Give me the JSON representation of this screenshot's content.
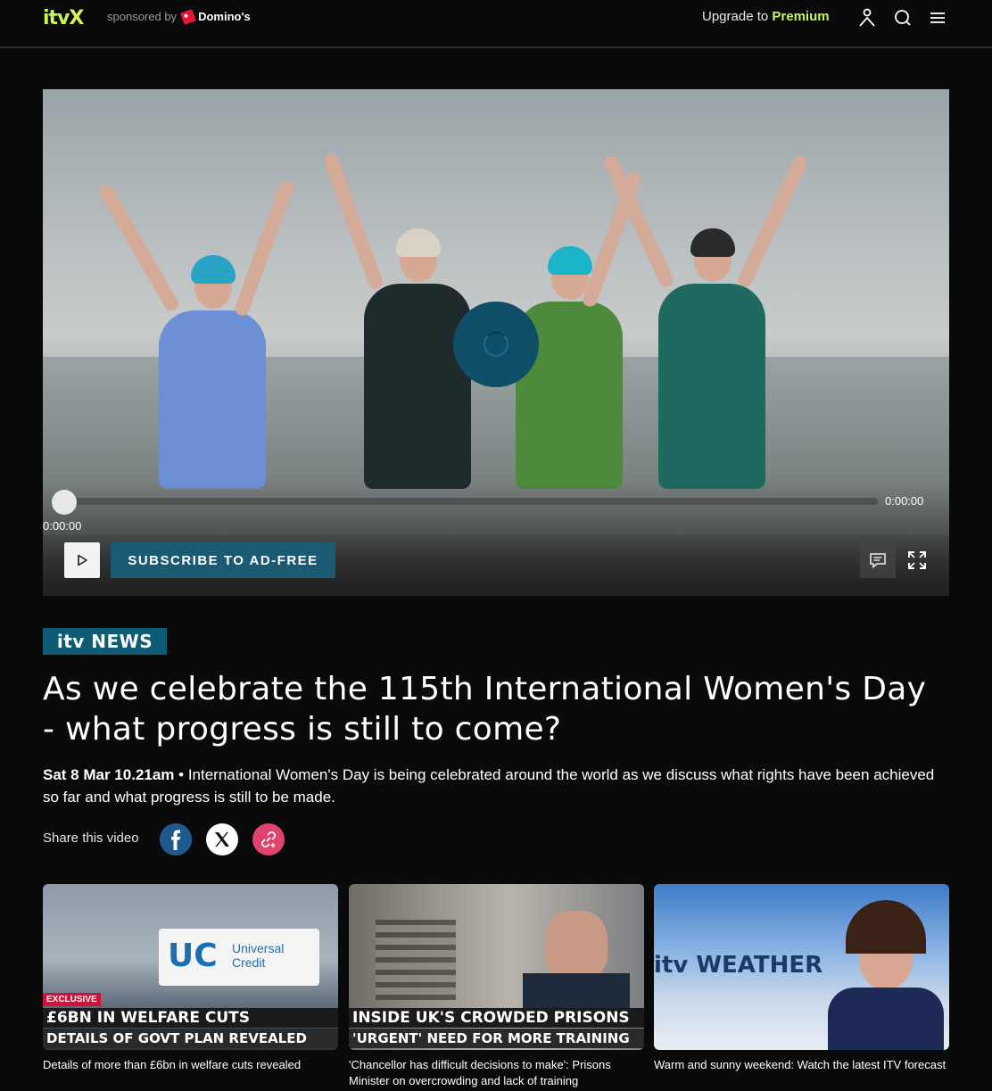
{
  "header": {
    "logo_text": "itv",
    "logo_x": "X",
    "sponsored_by": "sponsored by",
    "sponsor_name": "Domino's",
    "upgrade_prefix": "Upgrade to ",
    "upgrade_premium": "Premium",
    "icons": [
      "account-icon",
      "search-icon",
      "menu-icon"
    ]
  },
  "player": {
    "time_elapsed": "0:00:00",
    "time_total": "0:00:00",
    "subscribe_label": "SUBSCRIBE TO AD-FREE",
    "progress": 0
  },
  "article": {
    "brand": "itv NEWS",
    "headline": "As we celebrate the 115th International Women's Day - what progress is still to come?",
    "date": "Sat 8 Mar 10.21am",
    "separator": " • ",
    "description": "International Women's Day is being celebrated around the world as we discuss what rights have been achieved so far and what progress is still to be made.",
    "share_label": "Share this video"
  },
  "cards": [
    {
      "title": "Details of more than £6bn in welfare cuts revealed",
      "tag": "EXCLUSIVE",
      "strap_1": "£6BN IN WELFARE CUTS",
      "strap_2": "DETAILS OF GOVT PLAN REVEALED",
      "sign_text": "Universal Credit"
    },
    {
      "title": "'Chancellor has difficult decisions to make': Prisons Minister on overcrowding and lack of training",
      "strap_1": "INSIDE UK'S CROWDED PRISONS",
      "strap_2": "'URGENT' NEED FOR MORE TRAINING"
    },
    {
      "title": "Warm and sunny weekend: Watch the latest ITV forecast",
      "brand": "itv WEATHER"
    }
  ],
  "colors": {
    "background": "#0a0a0a",
    "accent": "#c7f35b",
    "news_blue": "#0d5b75",
    "player_blue": "#1a5a73",
    "facebook_blue": "#1f5a8c",
    "link_red": "#e0436b"
  }
}
